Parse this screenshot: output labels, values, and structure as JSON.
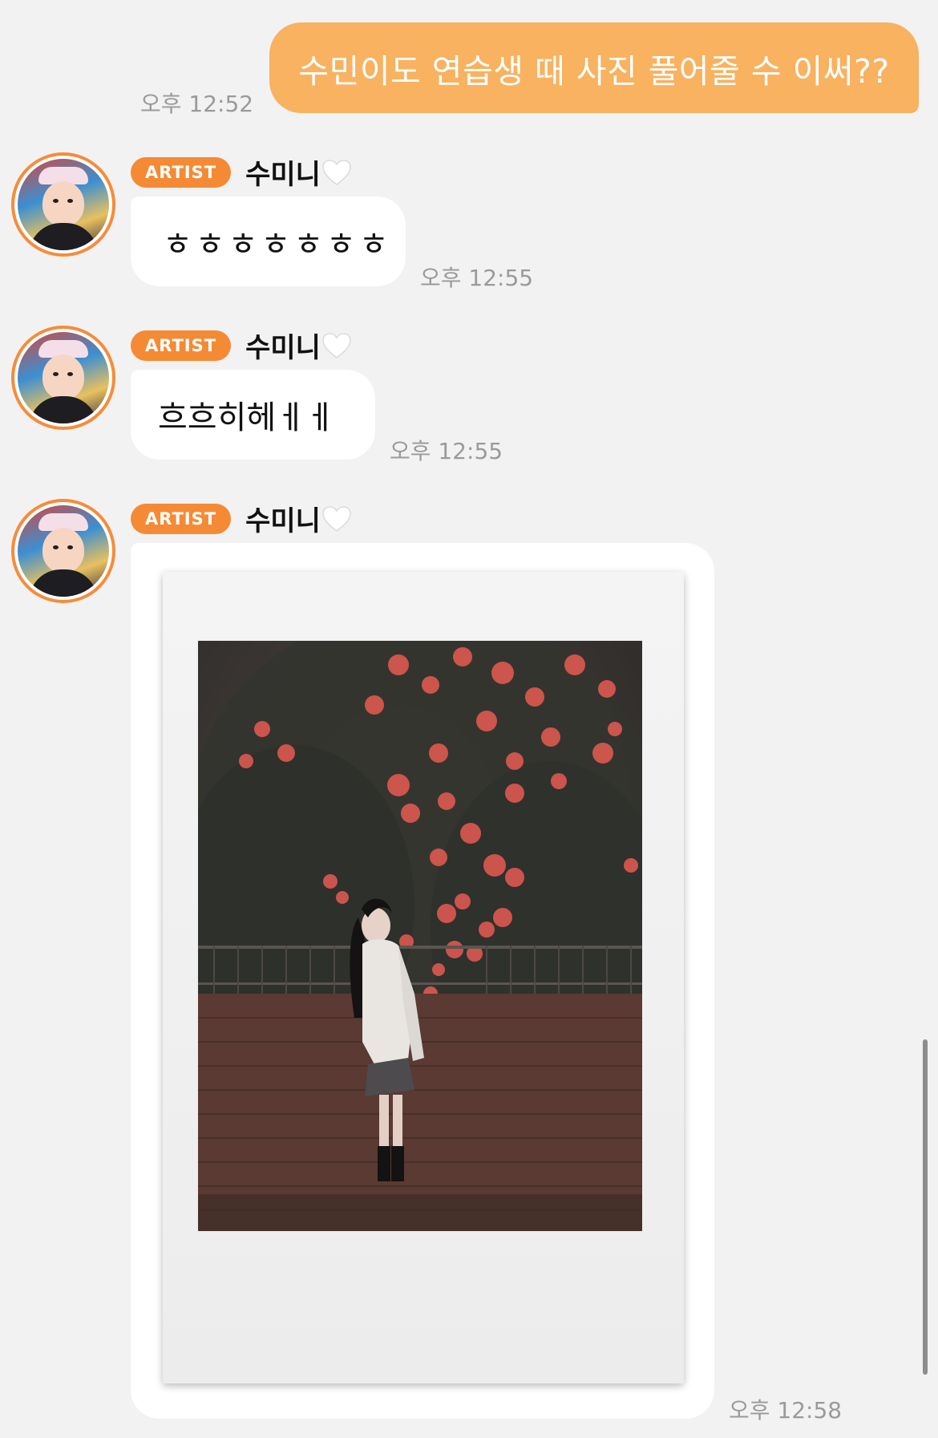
{
  "outgoing": {
    "text": "수민이도 연습생 때 사진 풀어줄 수 이써??",
    "time": "오후 12:52"
  },
  "sender": {
    "badge": "ARTIST",
    "name": "수미니",
    "heart_icon": "white-heart-icon",
    "avatar": "avatar-child-photo"
  },
  "messages": [
    {
      "text": "ㅎㅎㅎㅎㅎㅎㅎ",
      "time": "오후 12:55"
    },
    {
      "text": "흐흐히헤ㅔㅔ",
      "time": "오후 12:55"
    },
    {
      "image": "instant-photo-girl-by-rose-wall",
      "time": "오후 12:58"
    }
  ],
  "colors": {
    "outgoing_bubble": "#f8b260",
    "artist_badge": "#f58a35",
    "avatar_ring": "#f68c3a",
    "background": "#f2f2f2"
  }
}
